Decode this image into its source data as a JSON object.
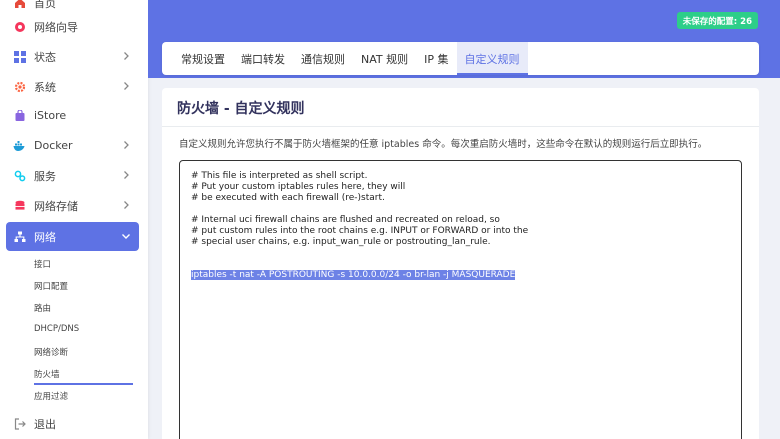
{
  "sidebar": {
    "items": [
      {
        "id": "overview",
        "label": "首页",
        "icon": "home-icon",
        "chevron": false
      },
      {
        "id": "wizard",
        "label": "网络向导",
        "icon": "wizard-icon",
        "chevron": false
      },
      {
        "id": "status",
        "label": "状态",
        "icon": "grid-icon",
        "chevron": true
      },
      {
        "id": "system",
        "label": "系统",
        "icon": "gear-icon",
        "chevron": true
      },
      {
        "id": "istore",
        "label": "iStore",
        "icon": "store-icon",
        "chevron": false
      },
      {
        "id": "docker",
        "label": "Docker",
        "icon": "docker-icon",
        "chevron": true
      },
      {
        "id": "services",
        "label": "服务",
        "icon": "services-icon",
        "chevron": true
      },
      {
        "id": "nas",
        "label": "网络存储",
        "icon": "storage-icon",
        "chevron": true
      },
      {
        "id": "network",
        "label": "网络",
        "icon": "network-icon",
        "chevron": true,
        "active": true
      }
    ],
    "subitems": [
      "接口",
      "网口配置",
      "路由",
      "DHCP/DNS",
      "网络诊断",
      "防火墙",
      "应用过滤"
    ],
    "active_subitem": "防火墙",
    "logout_label": "退出"
  },
  "header": {
    "unsaved_label": "未保存的配置: 26",
    "accent_color": "#5e72e4",
    "badge_color": "#2dce89"
  },
  "tabs": [
    {
      "label": "常规设置",
      "active": false
    },
    {
      "label": "端口转发",
      "active": false
    },
    {
      "label": "通信规则",
      "active": false
    },
    {
      "label": "NAT 规则",
      "active": false
    },
    {
      "label": "IP 集",
      "active": false
    },
    {
      "label": "自定义规则",
      "active": true
    }
  ],
  "page": {
    "title": "防火墙 - 自定义规则",
    "description": "自定义规则允许您执行不属于防火墙框架的任意 iptables 命令。每次重启防火墙时，这些命令在默认的规则运行后立即执行。"
  },
  "editor": {
    "lines": [
      "# This file is interpreted as shell script.",
      "# Put your custom iptables rules here, they will",
      "# be executed with each firewall (re-)start.",
      "",
      "# Internal uci firewall chains are flushed and recreated on reload, so",
      "# put custom rules into the root chains e.g. INPUT or FORWARD or into the",
      "# special user chains, e.g. input_wan_rule or postrouting_lan_rule.",
      "",
      "",
      "iptables -t nat -A POSTROUTING -s 10.0.0.0/24 -o br-lan -j MASQUERADE"
    ],
    "selected_line": "iptables -t nat -A POSTROUTING -s 10.0.0.0/24 -o br-lan -j MASQUERADE"
  }
}
